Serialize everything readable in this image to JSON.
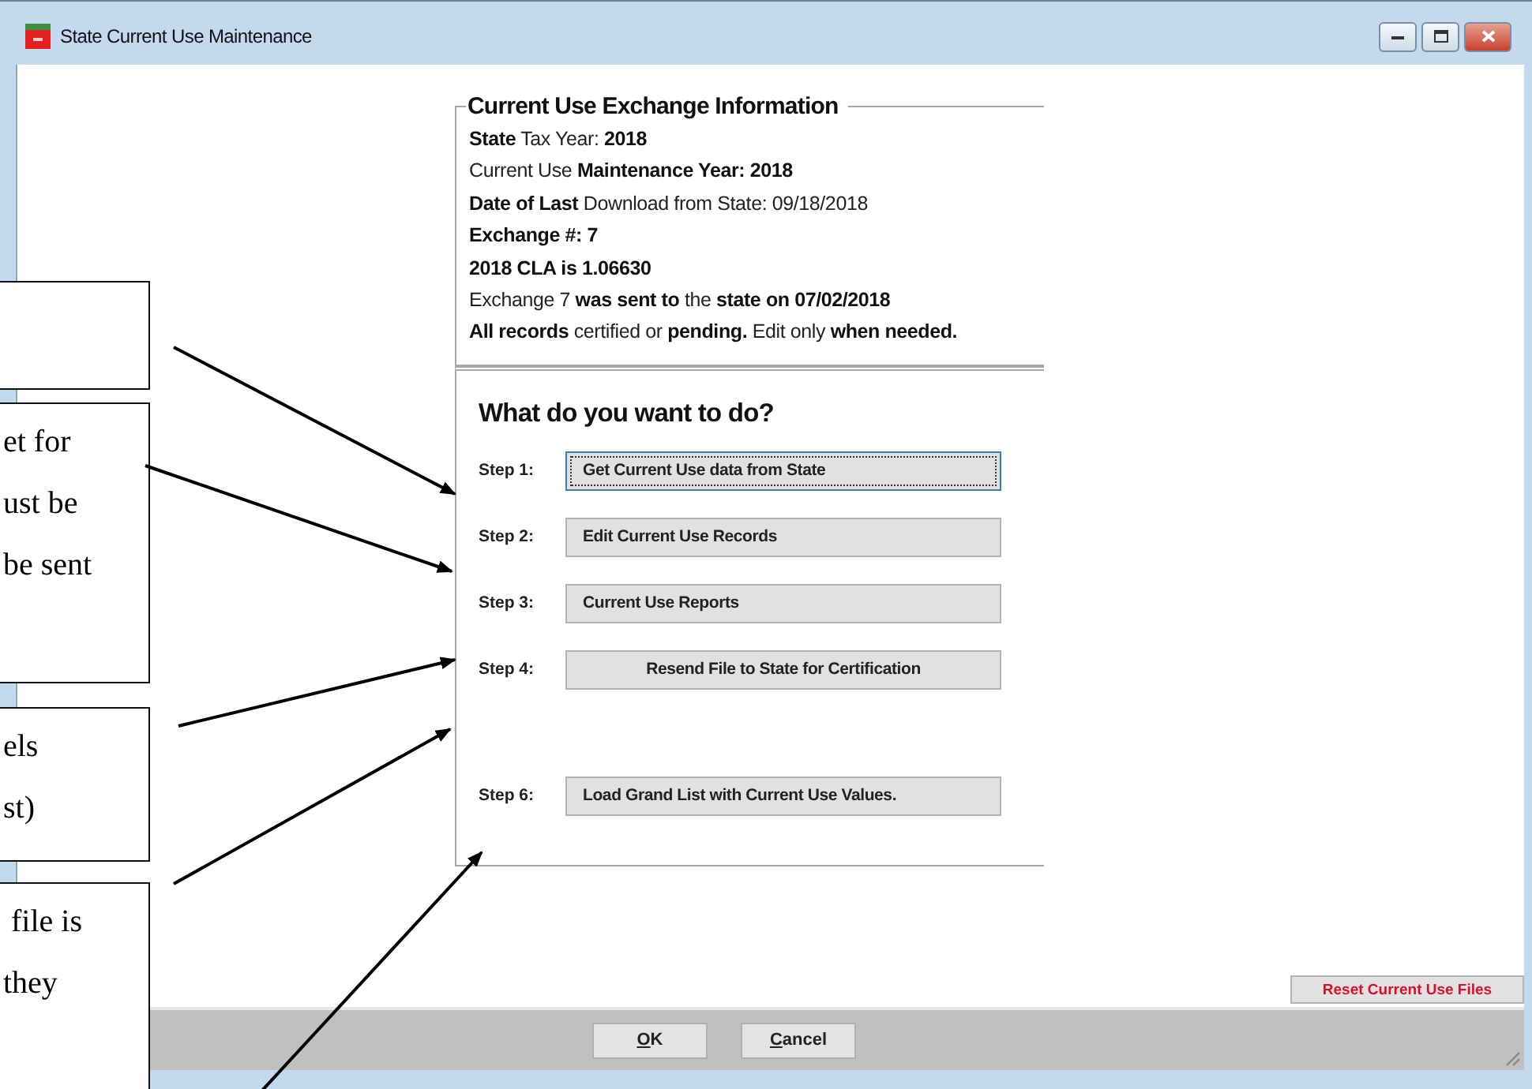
{
  "window": {
    "title": "State Current Use Maintenance"
  },
  "info": {
    "title": "Current Use Exchange Information",
    "lines": [
      "**State** Tax Year: **2018**",
      "Current Use **Maintenance Year: 2018**",
      "**Date of Last** Download from State: 09/18/2018",
      "**Exchange #: 7**",
      "**2018 CLA is 1.06630**",
      "Exchange 7 **was sent to** the **state on 07/02/2018**",
      "**All records** certified or **pending.**  Edit only **when needed.**"
    ]
  },
  "actions": {
    "title": "What do you want to do?",
    "steps": [
      {
        "label": "Step 1:",
        "button": "Get Current Use data from State",
        "focused": true,
        "centered": false
      },
      {
        "label": "Step 2:",
        "button": "Edit Current Use Records",
        "focused": false,
        "centered": false
      },
      {
        "label": "Step 3:",
        "button": "Current Use Reports",
        "focused": false,
        "centered": false
      },
      {
        "label": "Step 4:",
        "button": "Resend File to State for Certification",
        "focused": false,
        "centered": true
      },
      {
        "label": "Step 6:",
        "button": "Load Grand List with Current Use Values.",
        "focused": false,
        "centered": false
      }
    ]
  },
  "reset_button": "Reset Current Use Files",
  "footer_buttons": [
    {
      "mnemonic": "O",
      "rest": "K"
    },
    {
      "mnemonic": "C",
      "rest": "ancel"
    }
  ],
  "callouts": [
    {
      "kind": "blank"
    },
    {
      "kind": "text",
      "lines": [
        "et for",
        "ust be",
        "be sent"
      ]
    },
    {
      "kind": "text",
      "lines": [
        "els",
        "st)"
      ]
    },
    {
      "kind": "text",
      "lines": [
        " file is",
        "they"
      ]
    }
  ]
}
